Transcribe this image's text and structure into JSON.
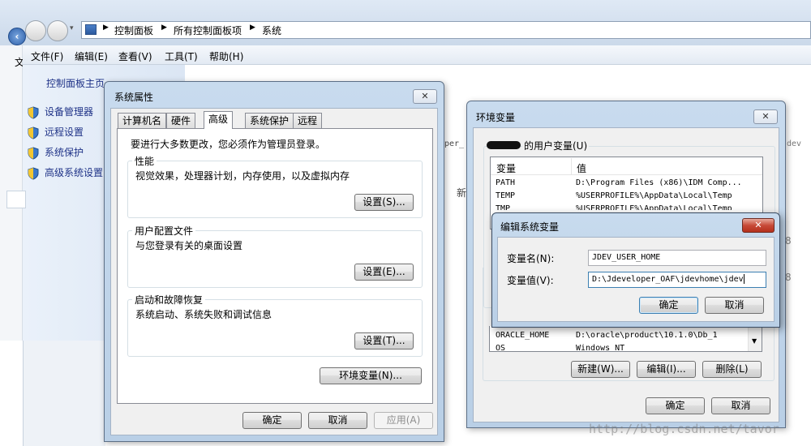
{
  "explorer": {
    "breadcrumb": [
      "控制面板",
      "所有控制面板项",
      "系统"
    ],
    "menu": [
      "文件(F)",
      "编辑(E)",
      "查看(V)",
      "工具(T)",
      "帮助(H)"
    ],
    "partial_menu_char": "文",
    "sidebar_home": "控制面板主页",
    "sidebar_links": [
      "设备管理器",
      "远程设置",
      "系统保护",
      "高级系统设置"
    ]
  },
  "sysprops": {
    "title": "系统属性",
    "tabs": [
      "计算机名",
      "硬件",
      "高级",
      "系统保护",
      "远程"
    ],
    "admin_note": "要进行大多数更改，您必须作为管理员登录。",
    "perf_title": "性能",
    "perf_desc": "视觉效果，处理器计划，内存使用，以及虚拟内存",
    "perf_btn": "设置(S)...",
    "profile_title": "用户配置文件",
    "profile_desc": "与您登录有关的桌面设置",
    "profile_btn": "设置(E)...",
    "startup_title": "启动和故障恢复",
    "startup_desc": "系统启动、系统失败和调试信息",
    "startup_btn": "设置(T)...",
    "env_btn": "环境变量(N)...",
    "ok": "确定",
    "cancel": "取消",
    "apply": "应用(A)"
  },
  "envvars": {
    "title": "环境变量",
    "user_vars_label": "的用户变量(U)",
    "col_var": "变量",
    "col_val": "值",
    "user_rows": [
      {
        "name": "PATH",
        "value": "D:\\Program Files (x86)\\IDM Comp..."
      },
      {
        "name": "TEMP",
        "value": "%USERPROFILE%\\AppData\\Local\\Temp"
      },
      {
        "name": "TMP",
        "value": "%USERPROFILE%\\AppData\\Local\\Temp"
      }
    ],
    "sys_rows": [
      {
        "name": "ORACLE_HOME",
        "value": "D:\\oracle\\product\\10.1.0\\Db_1"
      },
      {
        "name": "OS",
        "value": "Windows_NT"
      }
    ],
    "new_btn": "新建(W)...",
    "edit_btn": "编辑(I)...",
    "delete_btn": "删除(L)",
    "ok": "确定",
    "cancel": "取消",
    "bg_text_1": "per_",
    "bg_text_2": "新",
    "bg_text_3": "dev",
    "bg_text_4": "8"
  },
  "editvar": {
    "title": "编辑系统变量",
    "name_label": "变量名(N):",
    "name_value": "JDEV_USER_HOME",
    "value_label": "变量值(V):",
    "value_value": "D:\\Jdeveloper_OAF\\jdevhome\\jdev",
    "ok": "确定",
    "cancel": "取消"
  },
  "watermark": "http://blog.csdn.net/tavor"
}
